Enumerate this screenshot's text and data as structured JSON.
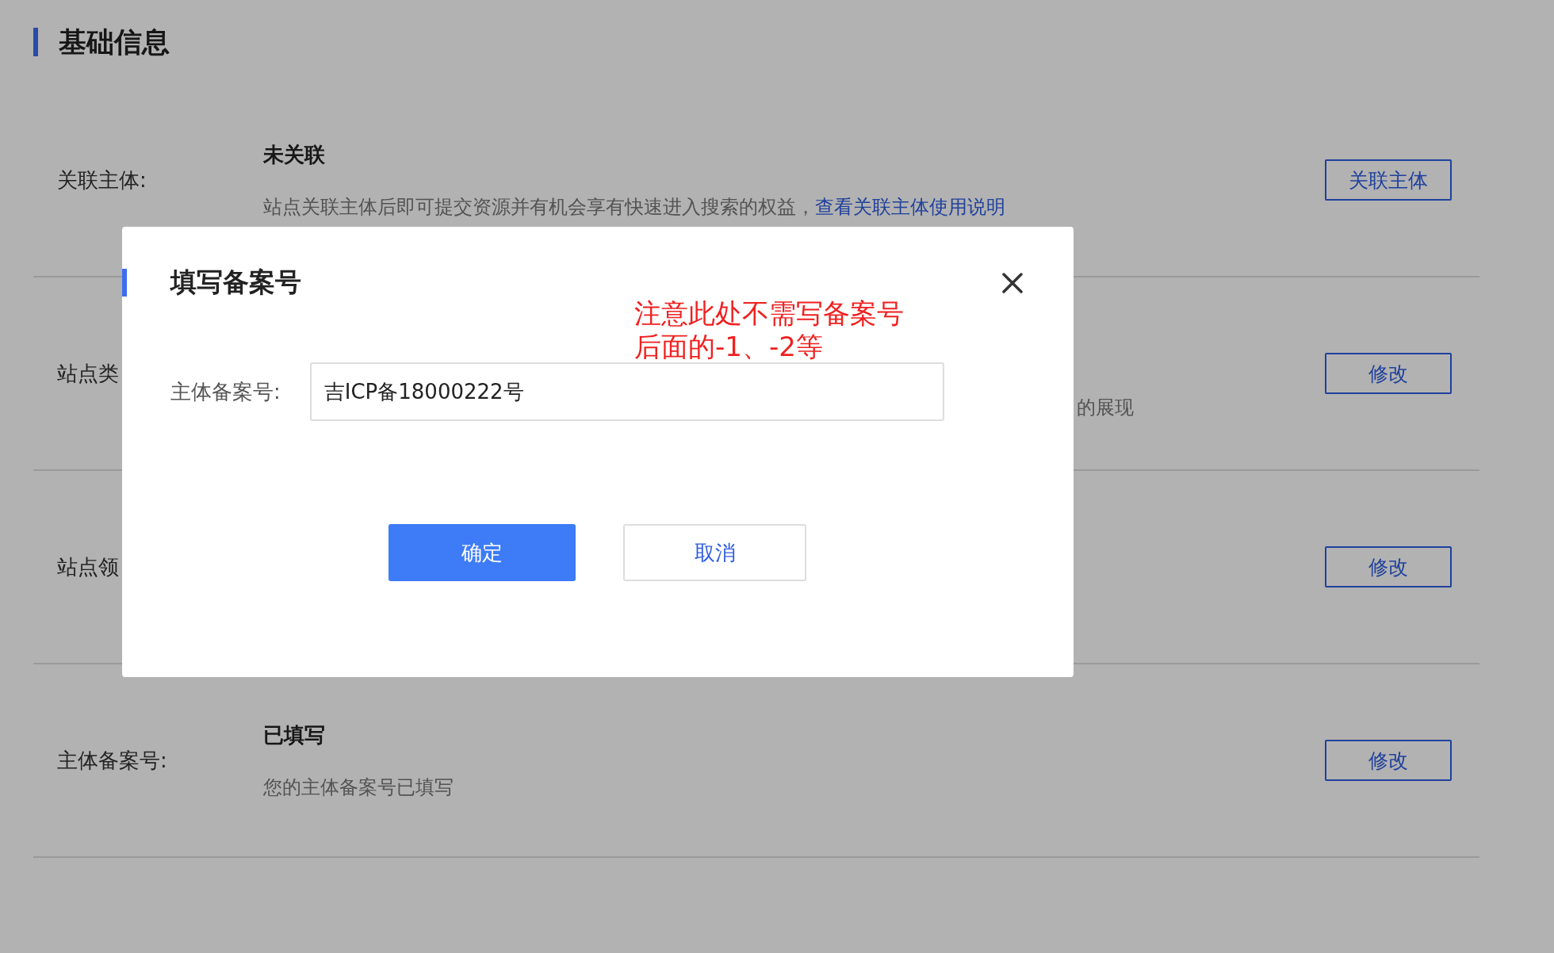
{
  "section_title": "基础信息",
  "rows": [
    {
      "label": "关联主体:",
      "title": "未关联",
      "description": "站点关联主体后即可提交资源并有机会享有快速进入搜索的权益，",
      "link": "查看关联主体使用说明",
      "button": "关联主体"
    },
    {
      "label": "站点类",
      "description": "的展现",
      "button": "修改"
    },
    {
      "label": "站点领",
      "button": "修改"
    },
    {
      "label": "主体备案号:",
      "title": "已填写",
      "description": "您的主体备案号已填写",
      "button": "修改"
    }
  ],
  "dialog": {
    "title": "填写备案号",
    "field_label": "主体备案号:",
    "field_value": "吉ICP备18000222号",
    "annotation_lines": [
      "注意此处不需写备案号",
      "后面的-1、-2等"
    ],
    "buttons": [
      {
        "label": "确定",
        "kind": "primary"
      },
      {
        "label": "取消",
        "kind": "secondary"
      }
    ]
  }
}
